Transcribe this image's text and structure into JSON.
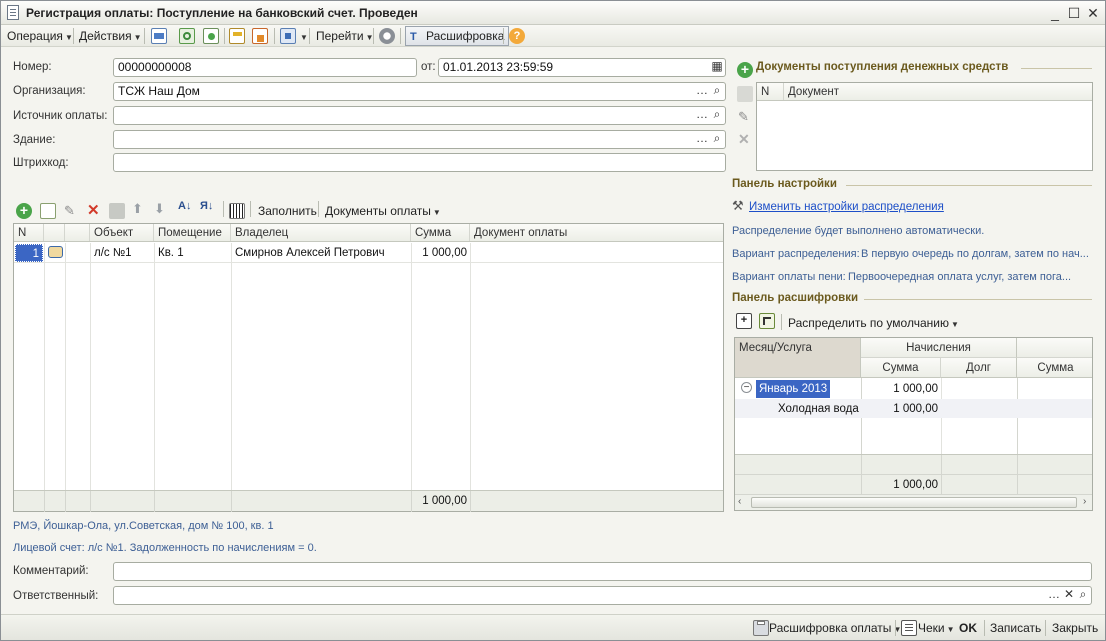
{
  "window": {
    "title": "Регистрация оплаты: Поступление на банковский счет. Проведен"
  },
  "toolbar": {
    "operation": "Операция",
    "actions": "Действия",
    "goto": "Перейти",
    "decode": "Расшифровка"
  },
  "form": {
    "number_label": "Номер:",
    "number_value": "00000000008",
    "date_label": "от:",
    "date_value": "01.01.2013 23:59:59",
    "org_label": "Организация:",
    "org_value": "ТСЖ Наш Дом",
    "source_label": "Источник оплаты:",
    "source_value": "",
    "building_label": "Здание:",
    "building_value": "",
    "barcode_label": "Штрихкод:",
    "barcode_value": ""
  },
  "table_toolbar": {
    "fill": "Заполнить",
    "payment_docs": "Документы оплаты"
  },
  "table": {
    "columns": [
      "N",
      "Объект",
      "Помещение",
      "Владелец",
      "Сумма",
      "Документ оплаты"
    ],
    "rows": [
      {
        "n": "1",
        "object": "л/с №1",
        "room": "Кв. 1",
        "owner": "Смирнов Алексей Петрович",
        "sum": "1 000,00",
        "doc": ""
      }
    ],
    "total": "1 000,00"
  },
  "info": {
    "address": "РМЭ, Йошкар-Ола, ул.Советская, дом № 100, кв. 1",
    "account": "Лицевой счет: л/с №1. Задолженность по начислениям = 0."
  },
  "bottom_fields": {
    "comment_label": "Комментарий:",
    "comment_value": "",
    "responsible_label": "Ответственный:",
    "responsible_value": ""
  },
  "right_panel": {
    "docs_title": "Документы поступления денежных средств",
    "docs_columns": [
      "N",
      "Документ"
    ],
    "settings_title": "Панель настройки",
    "settings_link": "Изменить настройки распределения",
    "auto_text": "Распределение будет выполнено автоматически.",
    "variant_label": "Вариант распределения:",
    "variant_value": "В первую очередь по долгам, затем по нач...",
    "penalty_label": "Вариант оплаты пени:",
    "penalty_value": "Первоочередная оплата услуг, затем пога...",
    "decode_title": "Панель расшифровки",
    "distribute_default": "Распределить по умолчанию",
    "decode_grid": {
      "col_month": "Месяц/Услуга",
      "col_accruals": "Начисления",
      "col_sum": "Сумма",
      "col_debt": "Долг",
      "col_sum2": "Сумма",
      "row1_label": "Январь 2013",
      "row1_sum": "1 000,00",
      "row2_label": "Холодная вода",
      "row2_sum": "1 000,00",
      "total_sum": "1 000,00"
    }
  },
  "bottom_bar": {
    "decode_payment": "Расшифровка оплаты",
    "checks": "Чеки",
    "ok": "OK",
    "save": "Записать",
    "close": "Закрыть"
  },
  "colors": {
    "section_title": "#6b5a1e",
    "link": "#1d4fc8",
    "info_text": "#3d5f95",
    "selection": "#3b66c4"
  }
}
